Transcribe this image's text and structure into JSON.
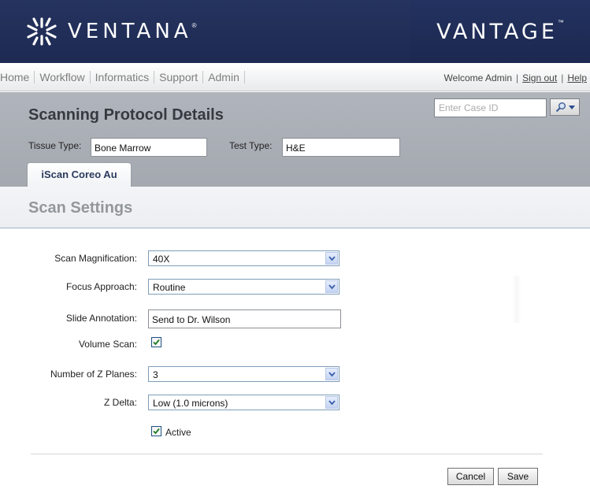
{
  "header": {
    "brand": "VENTANA",
    "brand_mark": "®",
    "product": "VANTAGE",
    "product_mark": "™"
  },
  "nav": {
    "items": [
      "Home",
      "Workflow",
      "Informatics",
      "Support",
      "Admin"
    ],
    "welcome": "Welcome Admin",
    "sign_out": "Sign out",
    "help": "Help",
    "separator": "|"
  },
  "title": "Scanning Protocol Details",
  "case_search": {
    "placeholder": "Enter Case ID"
  },
  "tissue": {
    "label": "Tissue Type:",
    "value": "Bone Marrow"
  },
  "test": {
    "label": "Test Type:",
    "value": "H&E"
  },
  "tab": {
    "label": "iScan Coreo Au"
  },
  "section_title": "Scan Settings",
  "form": {
    "magnification": {
      "label": "Scan Magnification:",
      "value": "40X"
    },
    "focus": {
      "label": "Focus Approach:",
      "value": "Routine"
    },
    "annotation": {
      "label": "Slide Annotation:",
      "value": "Send to Dr. Wilson"
    },
    "volume": {
      "label": "Volume Scan:",
      "checked": true
    },
    "z_planes": {
      "label": "Number of Z Planes:",
      "value": "3"
    },
    "z_delta": {
      "label": "Z Delta:",
      "value": "Low (1.0 microns)"
    },
    "active": {
      "label": "Active",
      "checked": true
    }
  },
  "buttons": {
    "cancel": "Cancel",
    "save": "Save"
  },
  "colors": {
    "header_bg": "#1d2a52",
    "title_bg": "#a8acb3",
    "accent": "#2a4b8c"
  }
}
